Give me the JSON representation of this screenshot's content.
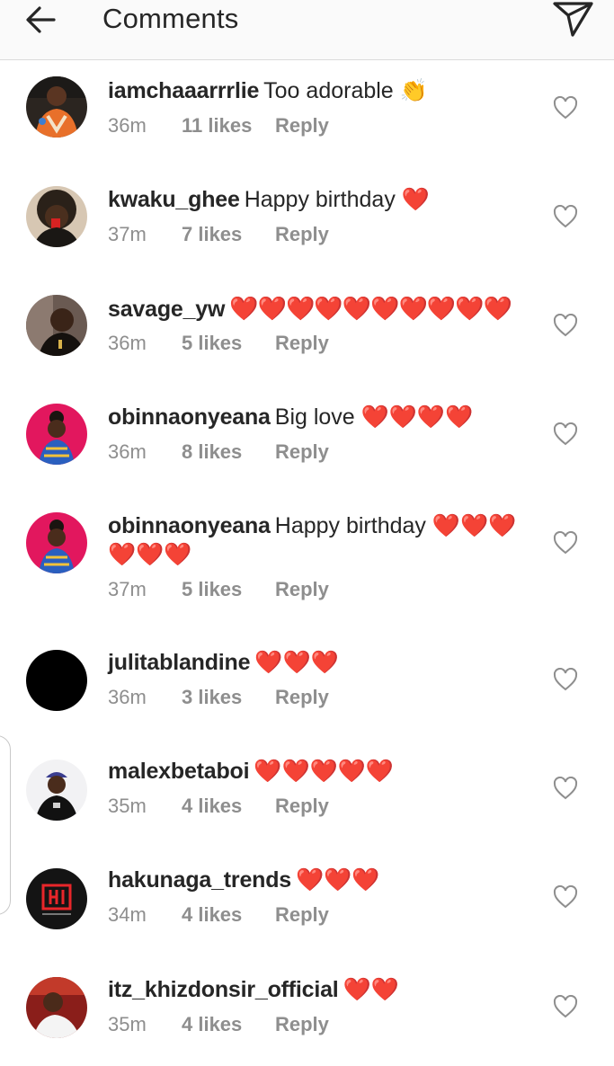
{
  "header": {
    "title": "Comments",
    "back_icon": "arrow-left-icon",
    "send_icon": "paper-plane-icon"
  },
  "colors": {
    "heart": "#e0142b",
    "meta_text": "#8e8e8e",
    "text": "#262626",
    "header_bg": "#fafafa"
  },
  "comments": [
    {
      "username": "iamchaaarrrlie",
      "text": "Too adorable 👏",
      "time": "36m",
      "likes": "11 likes",
      "reply": "Reply"
    },
    {
      "username": "kwaku_ghee",
      "text": "Happy birthday ❤️",
      "time": "37m",
      "likes": "7 likes",
      "reply": "Reply"
    },
    {
      "username": "savage_yw",
      "text": "❤️❤️❤️❤️❤️❤️❤️❤️❤️❤️",
      "time": "36m",
      "likes": "5 likes",
      "reply": "Reply"
    },
    {
      "username": "obinnaonyeana",
      "text": "Big love ❤️❤️❤️❤️",
      "time": "36m",
      "likes": "8 likes",
      "reply": "Reply"
    },
    {
      "username": "obinnaonyeana",
      "text": "Happy birthday ❤️❤️❤️❤️❤️❤️",
      "time": "37m",
      "likes": "5 likes",
      "reply": "Reply"
    },
    {
      "username": "julitablandine",
      "text": "❤️❤️❤️",
      "time": "36m",
      "likes": "3 likes",
      "reply": "Reply"
    },
    {
      "username": "malexbetaboi",
      "text": "❤️❤️❤️❤️❤️",
      "time": "35m",
      "likes": "4 likes",
      "reply": "Reply"
    },
    {
      "username": "hakunaga_trends",
      "text": "❤️❤️❤️",
      "time": "34m",
      "likes": "4 likes",
      "reply": "Reply"
    },
    {
      "username": "itz_khizdonsir_official",
      "text": "❤️❤️",
      "time": "35m",
      "likes": "4 likes",
      "reply": "Reply"
    }
  ]
}
